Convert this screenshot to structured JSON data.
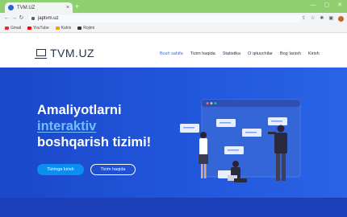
{
  "browser": {
    "tab_title": "TVM.UZ",
    "tab_close": "×",
    "new_tab": "+",
    "url": "japtvm.uz",
    "bookmarks": [
      {
        "label": "Gmail",
        "color": "#d93025"
      },
      {
        "label": "YouTube",
        "color": "#ff0000"
      },
      {
        "label": "Kalrix",
        "color": "#f2a100"
      },
      {
        "label": "Rojimi",
        "color": "#333333"
      }
    ]
  },
  "site": {
    "logo": "TVM.UZ",
    "nav": [
      "Bosh sahifa",
      "Tizim haqida",
      "Statistika",
      "O`qituvchilar",
      "Bog`lanish",
      "Kirish"
    ],
    "hero": {
      "line1": "Amaliyotlarni",
      "line2": "interaktiv",
      "line3": "boshqarish tizimi!",
      "btn_primary": "Tizimga kirish",
      "btn_secondary": "Tizim haqida"
    }
  },
  "colors": {
    "hero_blue": "#2157dc",
    "accent": "#6fc0ff",
    "nav_active": "#2d6df6",
    "tab_strip": "#8fcf6f"
  }
}
